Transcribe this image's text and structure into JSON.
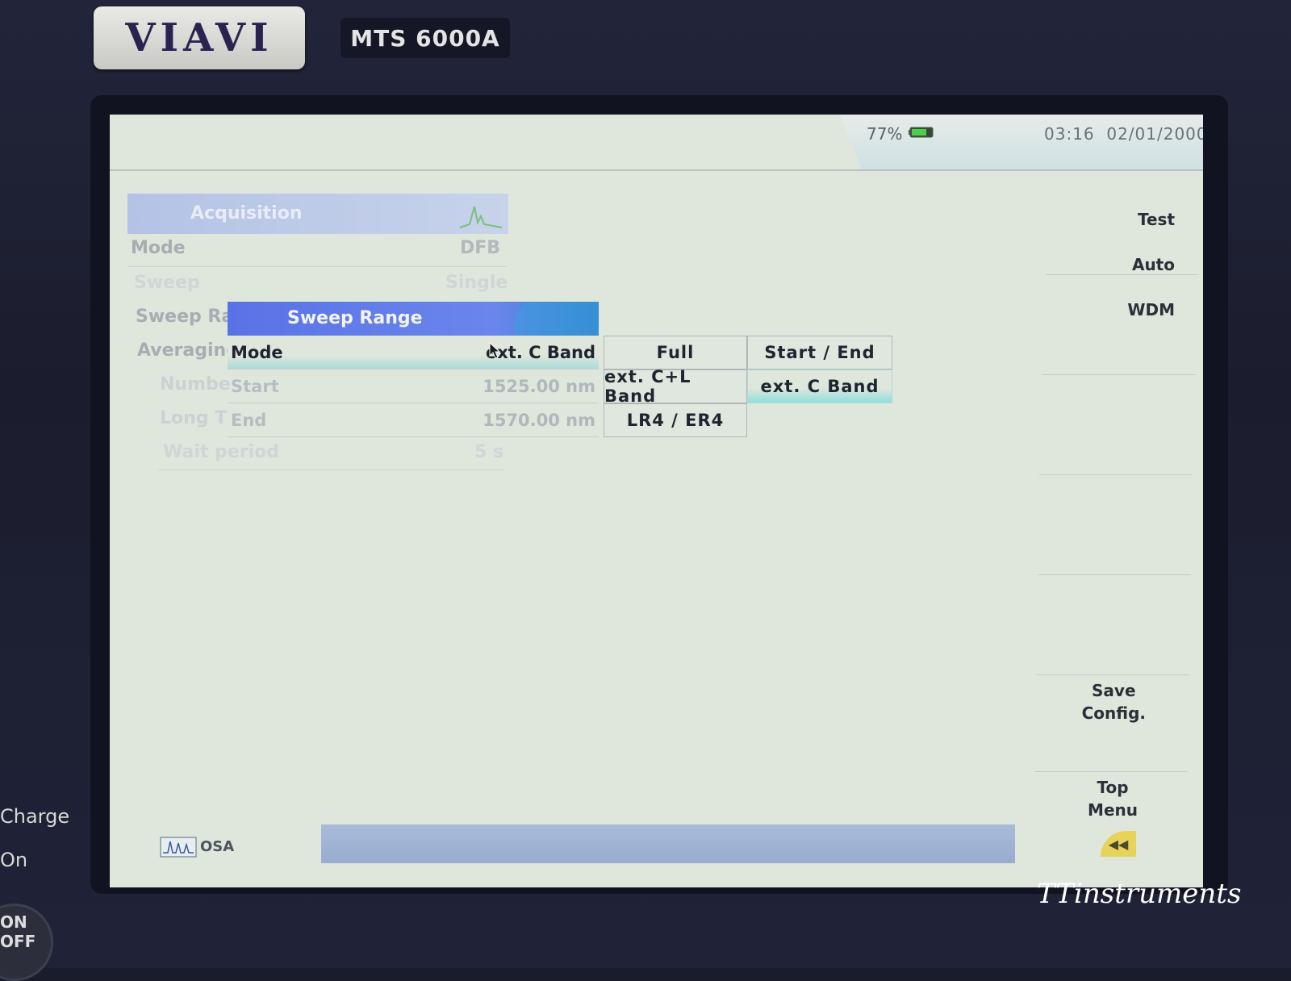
{
  "device": {
    "brand": "VIAVI",
    "model": "MTS 6000A",
    "side_labels": {
      "charge": "Charge",
      "on": "On",
      "power_on": "ON",
      "power_off": "OFF"
    },
    "watermark": "TTinstruments"
  },
  "status_bar": {
    "battery_percent": "77%",
    "battery_level": 0.77,
    "time": "03:16",
    "date": "02/01/2000"
  },
  "acquisition_panel": {
    "title": "Acquisition",
    "icon": "spectrum-icon",
    "rows": [
      {
        "label": "Mode",
        "value": "DFB"
      },
      {
        "label": "Sweep",
        "value": "Single"
      },
      {
        "label": "Sweep Ra"
      },
      {
        "label": "Averaging"
      },
      {
        "label": "Numbe"
      },
      {
        "label": "Long T"
      },
      {
        "label": "Wait period",
        "value": "5 s"
      }
    ]
  },
  "sweep_range_dialog": {
    "title": "Sweep Range",
    "rows": [
      {
        "label": "Mode",
        "value": "ext. C Band"
      },
      {
        "label": "Start",
        "value": "1525.00 nm"
      },
      {
        "label": "End",
        "value": "1570.00 nm"
      }
    ],
    "options": [
      {
        "label": "Full"
      },
      {
        "label": "Start / End"
      },
      {
        "label": "ext. C+L Band"
      },
      {
        "label": "ext. C Band",
        "selected": true
      },
      {
        "label": "LR4 / ER4"
      }
    ]
  },
  "softkeys": {
    "top": {
      "line1": "Test",
      "line2": "Auto",
      "line3": "WDM"
    },
    "save": "Save\nConfig.",
    "top_menu": "Top\nMenu"
  },
  "bottom": {
    "mode_label": "OSA",
    "mode_icon": "osa-waveform-icon",
    "back_icon": "double-chevron-left-icon"
  },
  "colors": {
    "screen_bg": "#dfe6dc",
    "dialog_header": "#5a72e6",
    "selection_highlight": "#8fe0dc",
    "bottom_bar": "#9eb0d2"
  }
}
